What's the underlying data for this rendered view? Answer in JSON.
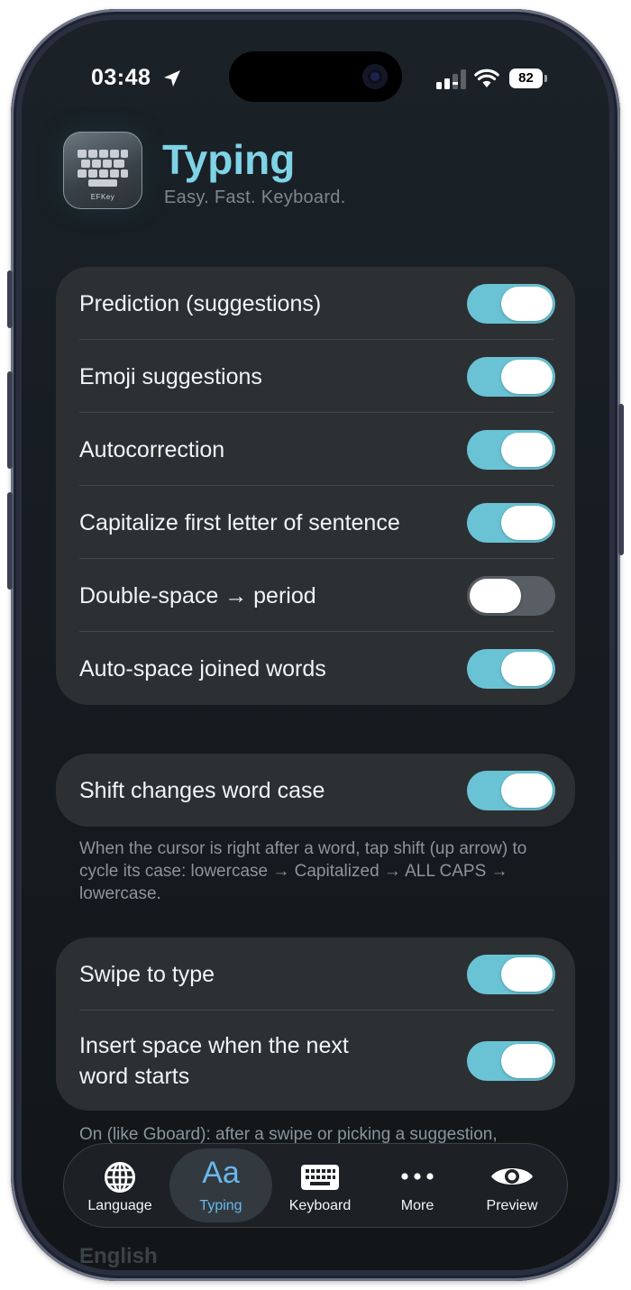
{
  "status_bar": {
    "time": "03:48",
    "battery": "82"
  },
  "header": {
    "title": "Typing",
    "subtitle": "Easy. Fast. Keyboard.",
    "app_icon_label": "EFKey"
  },
  "group1": {
    "rows": [
      {
        "label": "Prediction (suggestions)",
        "on": true
      },
      {
        "label": "Emoji suggestions",
        "on": true
      },
      {
        "label": "Autocorrection",
        "on": true
      },
      {
        "label": "Capitalize first letter of sentence",
        "on": true
      },
      {
        "label": "Double-space → period",
        "on": false
      },
      {
        "label": "Auto-space joined words",
        "on": true
      }
    ]
  },
  "group2": {
    "label": "Shift changes word case",
    "on": true,
    "footnote": "When the cursor is right after a word, tap shift (up arrow) to cycle its case: lowercase → Capitalized → ALL CAPS → lowercase."
  },
  "group3": {
    "rows": [
      {
        "label": "Swipe to type",
        "on": true
      },
      {
        "label": "Insert space when the next word starts",
        "on": true
      }
    ],
    "footnote": "On (like Gboard): after a swipe or picking a suggestion,"
  },
  "below_nav_text": "English",
  "nav": {
    "items": [
      {
        "label": "Language",
        "icon": "globe-icon"
      },
      {
        "label": "Typing",
        "icon": "Aa",
        "active": true
      },
      {
        "label": "Keyboard",
        "icon": "keyboard-icon"
      },
      {
        "label": "More",
        "icon": "more-dots-icon"
      },
      {
        "label": "Preview",
        "icon": "eye-icon"
      }
    ]
  },
  "colors": {
    "accent": "#7fd3e6",
    "toggle_on": "#6ac3d5",
    "toggle_off": "#585e63",
    "card": "#2c3033",
    "nav_active": "#6ab8ec"
  }
}
